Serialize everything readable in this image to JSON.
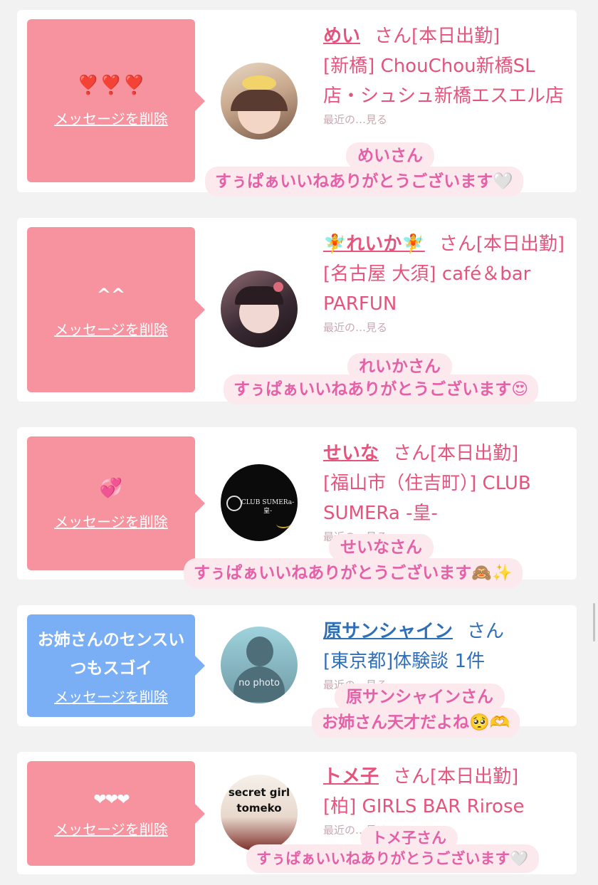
{
  "delete_label": "メッセージを削除",
  "cards": [
    {
      "message": "❣️❣️❣️",
      "name": "めい",
      "honorific": "さん[本日出勤]",
      "shop": "[新橋] ChouChou新橋SL店・シュシュ新橋エスエル店",
      "sub": "最近の…見る",
      "toast_name": "めいさん",
      "toast_text": "すぅぱぁいいねありがとうございます🤍"
    },
    {
      "message": "^^",
      "name": "🧚れいか🧚",
      "honorific": "さん[本日出勤]",
      "shop": "[名古屋 大須] café＆bar PARFUN",
      "sub": "最近の…見る",
      "toast_name": "れいかさん",
      "toast_text": "すぅぱぁいいねありがとうございます😍"
    },
    {
      "message": "💞",
      "name": "せいな",
      "honorific": "さん[本日出勤]",
      "shop": "[福山市（住吉町）] CLUB SUMERa -皇-",
      "sub": "最近の…見る",
      "avatar_text": "CLUB SUMERa-皇-",
      "toast_name": "せいなさん",
      "toast_text": "すぅぱぁいいねありがとうございます🙈✨"
    },
    {
      "message": "お姉さんのセンスいつもスゴイ",
      "name": "原サンシャイン",
      "honorific": "さん",
      "shop": "[東京都]体験談 1件",
      "sub": "最近の…見る",
      "avatar_text": "no photo",
      "toast_name": "原サンシャインさん",
      "toast_text": "お姉さん天才だよね🥺🫶"
    },
    {
      "message": "❤❤❤",
      "name": "トメ子",
      "honorific": "さん[本日出勤]",
      "shop": "[柏] GIRLS BAR Rirose",
      "sub": "最近の…見る",
      "avatar_text": "secret girl tomeko",
      "toast_name": "トメ子さん",
      "toast_text": "すぅぱぁいいねありがとうございます🤍"
    }
  ],
  "colors": {
    "bubble_pink": "#f7939f",
    "bubble_blue": "#7aaef5",
    "name_pink": "#e4547c",
    "name_blue": "#2f6eb8",
    "toast_bg": "#fbe9ee",
    "toast_text": "#e461a7"
  }
}
